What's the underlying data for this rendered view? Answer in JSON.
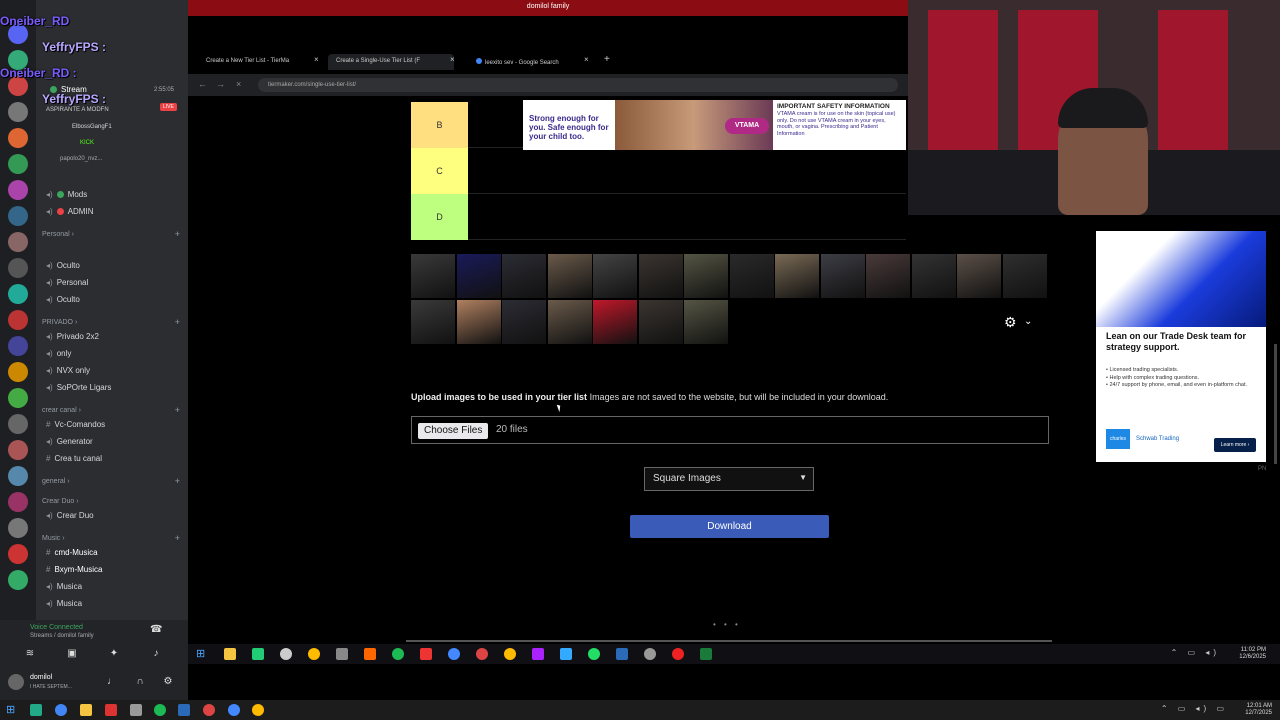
{
  "discord": {
    "overlay_names": [
      "Oneiber_RD",
      "YeffryFPS :",
      "Oneiber_RD :",
      "YeffryFPS :"
    ],
    "voice_user": "Stream",
    "voice_timer": "2:55:05",
    "voice_live": "LIVE",
    "voice_members": [
      "ASPIRANTE A MODFN",
      "ElbossGangF1",
      "KICK",
      "papolo20_nvz..."
    ],
    "channels_top": [
      {
        "icon": "speaker",
        "label": "Mods"
      },
      {
        "icon": "speaker",
        "label": "ADMIN"
      }
    ],
    "cat_personal": "Personal",
    "channels_personal": [
      "Oculto",
      "Personal",
      "Oculto"
    ],
    "cat_privado": "PRIVADO",
    "channels_privado": [
      "Privado 2x2",
      "only",
      "NVX only",
      "SoPOrte Ligars"
    ],
    "cat_crear": "crear canal",
    "channels_crear": [
      "Vc-Comandos",
      "Generator",
      "Crea tu canal"
    ],
    "cat_general": "general",
    "cat_duo": "Crear Duo",
    "channels_duo": [
      "Crear Duo"
    ],
    "cat_music": "Music",
    "channels_music": [
      "cmd-Musica",
      "Bxym-Musica",
      "Musica",
      "Musica"
    ],
    "voice_connected": "Voice Connected",
    "voice_channel": "Streams / domilol family",
    "username": "domilol",
    "user_status": "I HATE SEPTEM..."
  },
  "window_title": "domilol family",
  "browser": {
    "tabs": [
      {
        "label": "Create a New Tier List - TierMa",
        "active": false
      },
      {
        "label": "Create a Single-Use Tier List (F",
        "active": true
      },
      {
        "label": "leexito sev - Google Search",
        "active": false
      }
    ],
    "url": "tiermaker.com/single-use-tier-list/"
  },
  "tiers": [
    {
      "label": "B",
      "color": "#ffdf80"
    },
    {
      "label": "C",
      "color": "#ffff7f"
    },
    {
      "label": "D",
      "color": "#bfff7f"
    }
  ],
  "ad1": {
    "headline": "Strong enough for you. Safe enough for your child too.",
    "brand": "VTAMA",
    "safety_title": "IMPORTANT SAFETY INFORMATION",
    "safety_body": "VTAMA cream is for use on the skin (topical use) only. Do not use VTAMA cream in your eyes, mouth, or vagina. Prescribing and Patient Information"
  },
  "thumbnail_count": 21,
  "upload": {
    "label_bold": "Upload images to be used in your tier list",
    "label_rest": "Images are not saved to the website, but will be included in your download.",
    "choose_label": "Choose Files",
    "files_count": "20 files"
  },
  "image_mode_select": "Square Images",
  "download_label": "Download",
  "ad2": {
    "title": "Lean on our Trade Desk team for strategy support.",
    "bullets": [
      "Licensed trading specialists.",
      "Help with complex trading questions.",
      "24/7 support by phone, email, and even in-platform chat."
    ],
    "logo1": "charles schwab",
    "logo2": "Schwab Trading",
    "cta": "Learn more ›",
    "corner": "PN"
  },
  "inner_clock": {
    "time": "11:02 PM",
    "date": "12/6/2025"
  },
  "outer_clock": {
    "time": "12:01 AM",
    "date": "12/7/2025"
  },
  "colors": {
    "red_bar": "#8b0d13",
    "download_btn": "#3b5bb8"
  }
}
